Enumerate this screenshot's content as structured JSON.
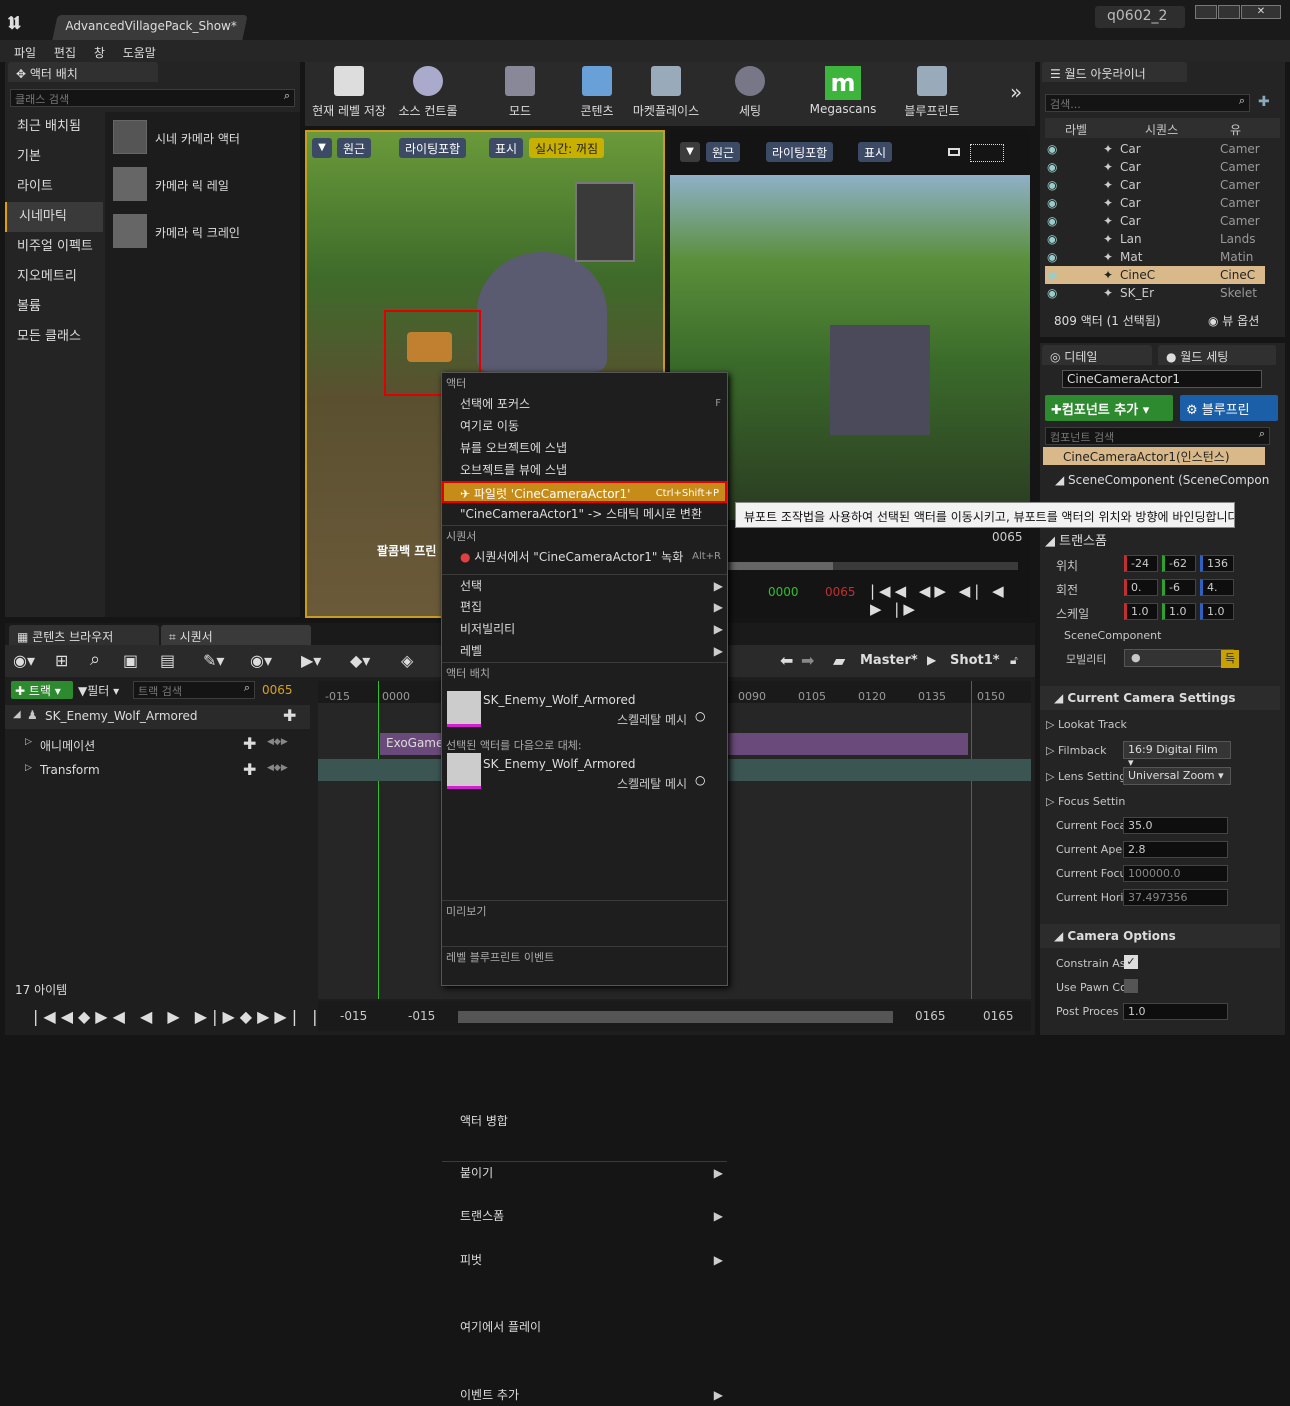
{
  "window": {
    "doc_tab": "AdvancedVillagePack_Show*",
    "user_badge": "q0602_2"
  },
  "menu": [
    "파일",
    "편집",
    "창",
    "도움말"
  ],
  "place_panel": {
    "title": "액터 배치",
    "search_placeholder": "클래스 검색",
    "categories": [
      "최근 배치됨",
      "기본",
      "라이트",
      "시네마틱",
      "비주얼 이펙트",
      "지오메트리",
      "볼륨",
      "모든 클래스"
    ],
    "selected_category": "시네마틱",
    "items": [
      "시네 카메라 액터",
      "카메라 릭 레일",
      "카메라 릭 크레인"
    ]
  },
  "toolbar": [
    "현재 레벨 저장",
    "소스 컨트롤",
    "모드",
    "콘텐츠",
    "마켓플레이스",
    "세팅",
    "Megascans",
    "블루프린트"
  ],
  "viewport_left": {
    "buttons": [
      "원근",
      "라이팅포함",
      "표시"
    ],
    "realtime": "실시간: 꺼짐",
    "overlay_text": "팔콤백 프린"
  },
  "viewport_right": {
    "buttons": [
      "원근",
      "라이팅포함",
      "표시"
    ],
    "frame": "0065",
    "time_start": "0000",
    "time_cur": "0065"
  },
  "context_menu": {
    "sec_actor": "액터",
    "items1": [
      {
        "label": "선택에 포커스",
        "shortcut": "F"
      },
      {
        "label": "여기로 이동"
      },
      {
        "label": "뷰를 오브젝트에 스냅"
      },
      {
        "label": "오브젝트를 뷰에 스냅"
      }
    ],
    "pilot": {
      "label": "파일럿 'CineCameraActor1'",
      "shortcut": "Ctrl+Shift+P"
    },
    "convert": "\"CineCameraActor1\" -> 스태틱 메시로 변환",
    "sec_seq": "시퀀서",
    "record": {
      "label": "시퀀서에서 \"CineCameraActor1\" 녹화",
      "shortcut": "Alt+R"
    },
    "submenus1": [
      "선택",
      "편집",
      "비저빌리티",
      "레벨"
    ],
    "sec_place": "액터 배치",
    "place_asset": {
      "name": "SK_Enemy_Wolf_Armored",
      "type": "스켈레탈 메시"
    },
    "sec_replace": "선택된 액터를 다음으로 대체:",
    "replace_asset": {
      "name": "SK_Enemy_Wolf_Armored",
      "type": "스켈레탈 메시"
    },
    "merge": "액터 병합",
    "submenus2": [
      "붙이기",
      "트랜스폼",
      "피벗"
    ],
    "sec_preview": "미리보기",
    "play_here": "여기에서 플레이",
    "sec_lbp": "레벨 블루프린트 이벤트",
    "add_event": "이벤트 추가"
  },
  "tooltip": "뷰포트 조작법을 사용하여 선택된 액터를 이동시키고, 뷰포트를 액터의 위치와 방향에 바인딩합니다.",
  "outliner": {
    "title": "월드 아웃라이너",
    "search_placeholder": "검색...",
    "columns": [
      "라벨",
      "시퀀스",
      "유"
    ],
    "rows": [
      {
        "label": "Car",
        "type": "Camer"
      },
      {
        "label": "Car",
        "type": "Camer"
      },
      {
        "label": "Car",
        "type": "Camer"
      },
      {
        "label": "Car",
        "type": "Camer"
      },
      {
        "label": "Car",
        "type": "Camer"
      },
      {
        "label": "Lan",
        "type": "Lands"
      },
      {
        "label": "Mat",
        "type": "Matin"
      },
      {
        "label": "CineC",
        "type": "CineC"
      },
      {
        "label": "SK_Er",
        "type": "Skelet"
      }
    ],
    "selected_row": 7,
    "count": "809 액터 (1 선택됨)",
    "view_options": "뷰 옵션"
  },
  "details": {
    "tab_details": "디테일",
    "tab_world": "월드 세팅",
    "actor_name": "CineCameraActor1",
    "add_component": "컴포넌트 추가",
    "blueprint": "블루프린",
    "comp_search": "컴포넌트 검색",
    "instance": "CineCameraActor1(인스턴스)",
    "scene_comp": "SceneComponent (SceneCompone",
    "transform": "트랜스폼",
    "location_label": "위치",
    "rotation_label": "회전",
    "scale_label": "스케일",
    "location": [
      "-24",
      "-62",
      "136"
    ],
    "rotation": [
      "0.",
      "-6",
      "4."
    ],
    "scale": [
      "1.0",
      "1.0",
      "1.0"
    ],
    "scene_comp_short": "SceneComponent",
    "mobility": "모빌리티",
    "mobility_opt": "득",
    "cam_settings": "Current Camera Settings",
    "lookat": "Lookat Track",
    "filmback": "Filmback",
    "filmback_val": "16:9 Digital Film",
    "lens": "Lens Setting",
    "lens_val": "Universal Zoom",
    "focus": "Focus Settin",
    "props": [
      {
        "label": "Current Foca",
        "value": "35.0"
      },
      {
        "label": "Current Aper",
        "value": "2.8"
      },
      {
        "label": "Current Focu",
        "value": "100000.0"
      },
      {
        "label": "Current Horiz",
        "value": "37.497356"
      }
    ],
    "cam_options": "Camera Options",
    "opts": [
      {
        "label": "Constrain As",
        "checked": true
      },
      {
        "label": "Use Pawn Co",
        "checked": false
      },
      {
        "label": "Post Proces",
        "value": "1.0"
      }
    ]
  },
  "bottom_tabs": [
    "콘텐츠 브라우저",
    "시퀀서"
  ],
  "sequencer": {
    "track_btn": "트랙",
    "filter_btn": "필터",
    "search_placeholder": "트랙 검색",
    "frame": "0065",
    "breadcrumb": [
      "Master*",
      "Shot1*"
    ],
    "tracks": [
      "SK_Enemy_Wolf_Armored",
      "애니메이션",
      "Transform"
    ],
    "clip": "ExoGame",
    "ticks": [
      "-015",
      "0000",
      "0090",
      "0105",
      "0120",
      "0135",
      "0150"
    ],
    "bottom_left": [
      "-015",
      "-015"
    ],
    "bottom_right": [
      "0165",
      "0165"
    ],
    "items_count": "17 아이템"
  }
}
